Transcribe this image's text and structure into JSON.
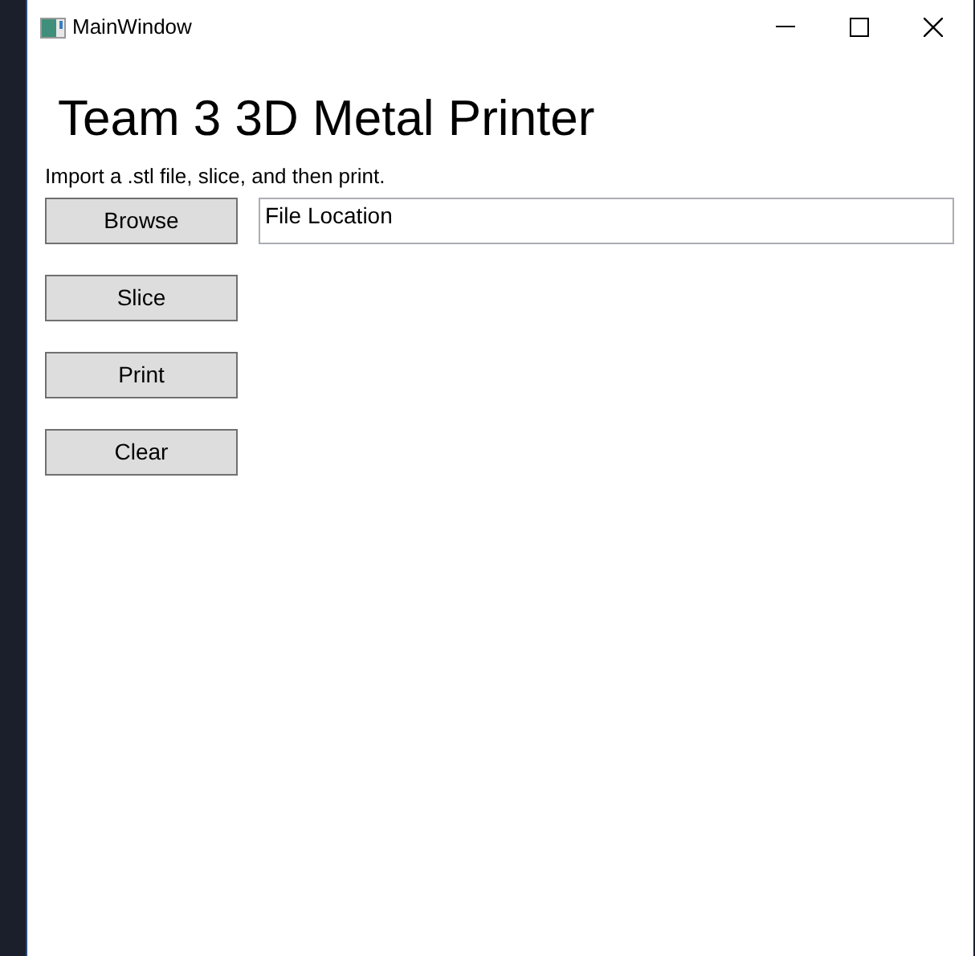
{
  "window": {
    "title": "MainWindow"
  },
  "heading": "Team 3 3D Metal Printer",
  "instructions": "Import a .stl file, slice, and then print.",
  "buttons": [
    {
      "label": "Browse"
    },
    {
      "label": "Slice"
    },
    {
      "label": "Print"
    },
    {
      "label": "Clear"
    }
  ],
  "file_field": {
    "value": "File Location"
  }
}
